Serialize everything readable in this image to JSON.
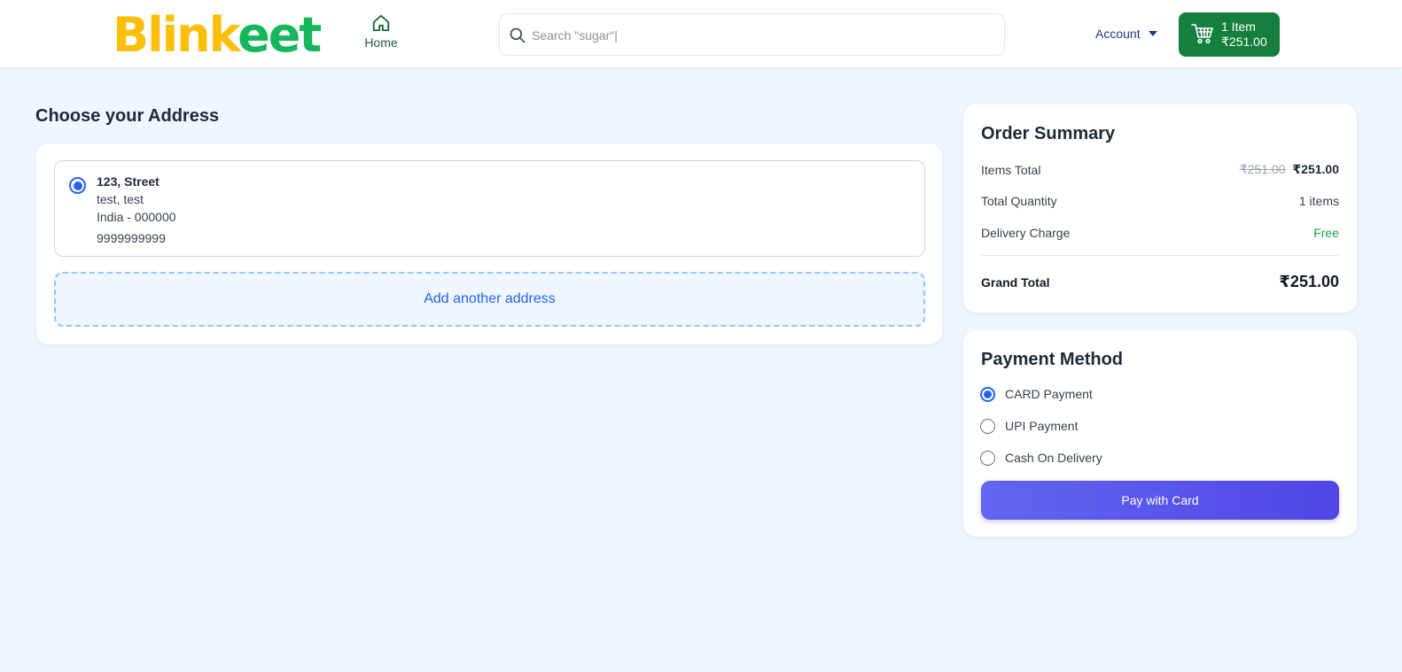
{
  "header": {
    "logo_part1": "Blink",
    "logo_part2": "eet",
    "home_label": "Home",
    "search_placeholder": "Search \"sugar\"|",
    "account_label": "Account",
    "cart_count": "1 Item",
    "cart_total": "₹251.00"
  },
  "address_section": {
    "title": "Choose your Address",
    "addresses": [
      {
        "line1": "123, Street",
        "line2": "test, test",
        "line3": "India - 000000",
        "phone": "9999999999",
        "selected": true
      }
    ],
    "add_button": "Add another address"
  },
  "order_summary": {
    "title": "Order Summary",
    "items_total_label": "Items Total",
    "items_total_original": "₹251.00",
    "items_total_value": "₹251.00",
    "total_quantity_label": "Total Quantity",
    "total_quantity_value": "1 items",
    "delivery_label": "Delivery Charge",
    "delivery_value": "Free",
    "grand_total_label": "Grand Total",
    "grand_total_value": "₹251.00"
  },
  "payment": {
    "title": "Payment Method",
    "options": [
      {
        "label": "CARD Payment",
        "selected": true
      },
      {
        "label": "UPI Payment",
        "selected": false
      },
      {
        "label": "Cash On Delivery",
        "selected": false
      }
    ],
    "pay_button": "Pay with Card"
  },
  "colors": {
    "brand_yellow": "#fbbf0a",
    "brand_green": "#16b75a",
    "cart_green": "#15803d",
    "accent_blue": "#2563eb",
    "pay_indigo": "#4f46e5",
    "page_bg": "#eff6ff"
  },
  "icons": {
    "home": "home-icon",
    "search": "search-icon",
    "cart": "cart-icon",
    "account_caret": "caret-down-icon"
  }
}
